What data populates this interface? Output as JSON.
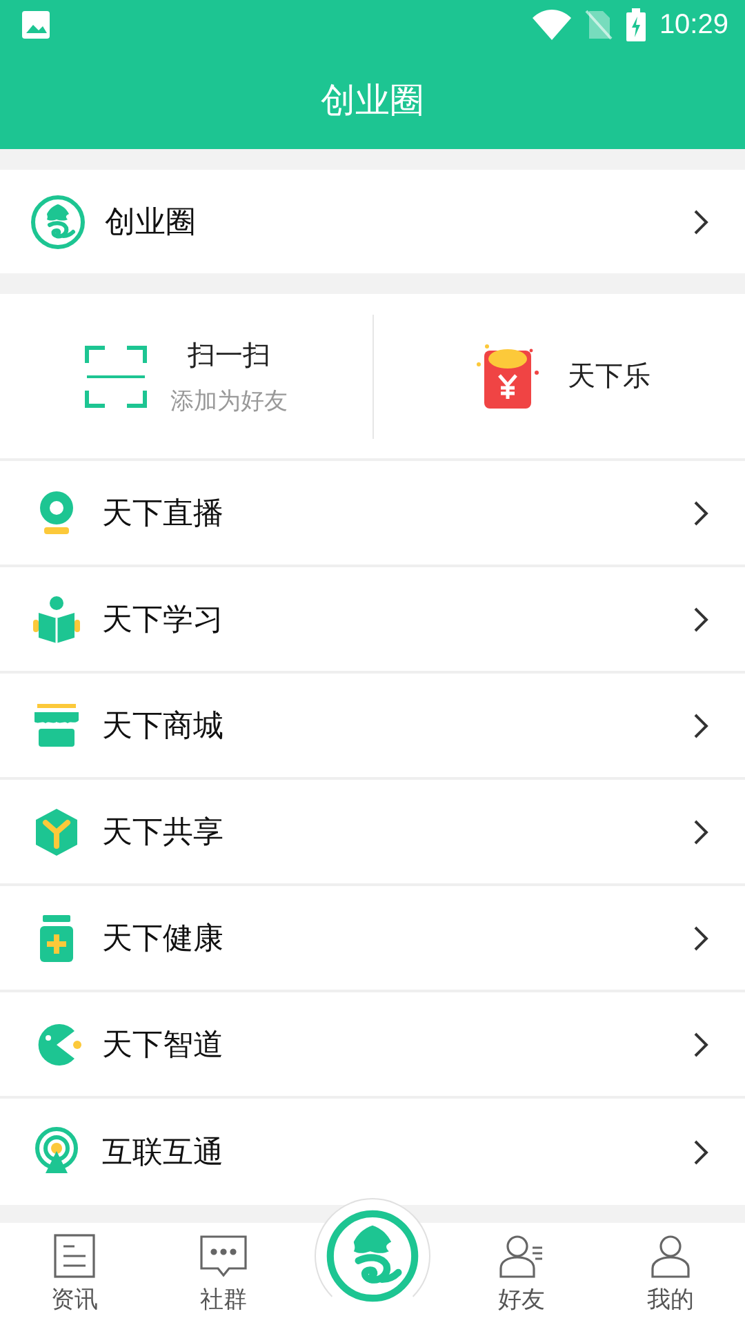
{
  "status_bar": {
    "time": "10:29"
  },
  "header": {
    "title": "创业圈"
  },
  "circle_row": {
    "label": "创业圈"
  },
  "quick_actions": [
    {
      "kind": "scan",
      "title": "扫一扫",
      "subtitle": "添加为好友"
    },
    {
      "kind": "redpacket",
      "title": "天下乐"
    }
  ],
  "menu": [
    {
      "kind": "live",
      "label": "天下直播"
    },
    {
      "kind": "study",
      "label": "天下学习"
    },
    {
      "kind": "shop",
      "label": "天下商城"
    },
    {
      "kind": "share",
      "label": "天下共享"
    },
    {
      "kind": "health",
      "label": "天下健康"
    },
    {
      "kind": "wisdom",
      "label": "天下智道"
    },
    {
      "kind": "connect",
      "label": "互联互通"
    }
  ],
  "bottom_nav": [
    {
      "kind": "news",
      "label": "资讯"
    },
    {
      "kind": "community",
      "label": "社群"
    },
    {
      "kind": "center"
    },
    {
      "kind": "friends",
      "label": "好友"
    },
    {
      "kind": "me",
      "label": "我的"
    }
  ]
}
